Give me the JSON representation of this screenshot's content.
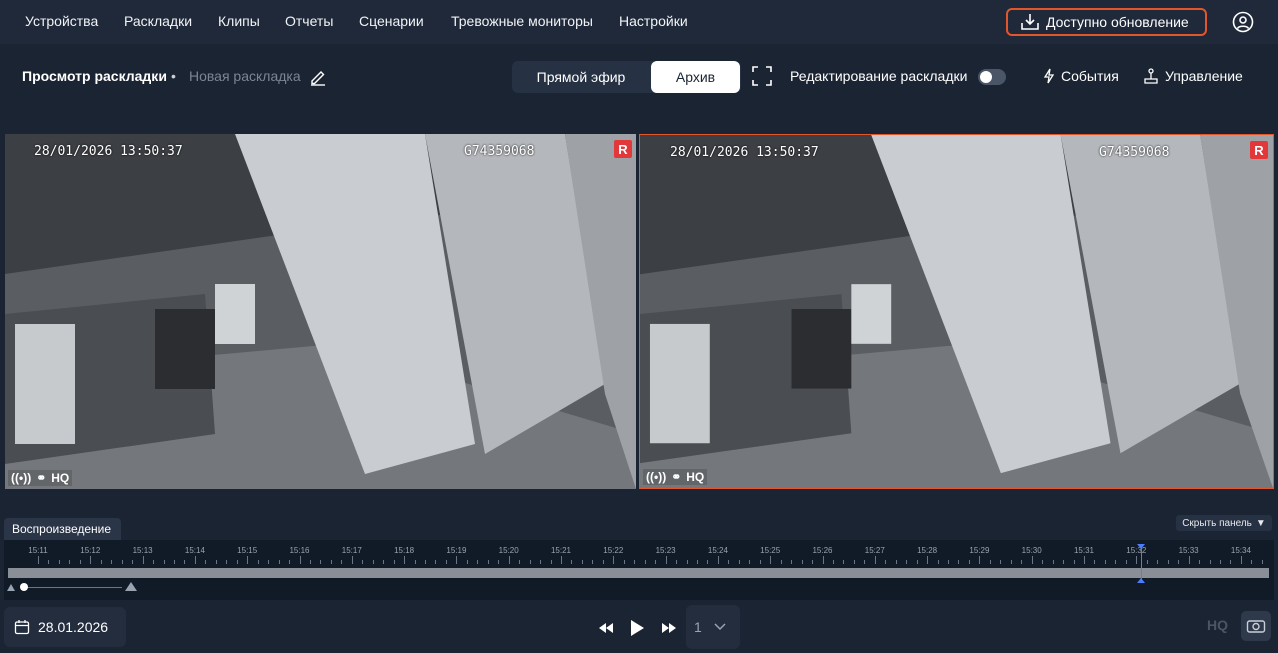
{
  "nav": {
    "items": [
      "Устройства",
      "Раскладки",
      "Клипы",
      "Отчеты",
      "Сценарии",
      "Тревожные мониторы",
      "Настройки"
    ],
    "update_label": "Доступно обновление",
    "update_icon": "download-icon",
    "user_icon": "user-circle-icon"
  },
  "toolbar": {
    "title": "Просмотр раскладки",
    "separator": "•",
    "layout_name": "Новая раскладка",
    "mode_live": "Прямой эфир",
    "mode_archive": "Архив",
    "active_mode": "Архив",
    "edit_layout_label": "Редактирование раскладки",
    "edit_layout_enabled": false,
    "events_label": "События",
    "control_label": "Управление"
  },
  "tiles": [
    {
      "timestamp": "28/01/2026 13:50:37",
      "camera_id": "G74359068",
      "rec_badge": "R",
      "quality": "HQ",
      "selected": false
    },
    {
      "timestamp": "28/01/2026 13:50:37",
      "camera_id": "G74359068",
      "rec_badge": "R",
      "quality": "HQ",
      "selected": true
    }
  ],
  "timeline": {
    "tab_label": "Воспроизведение",
    "hide_panel_label": "Скрыть панель",
    "ticks": [
      "15:11",
      "15:12",
      "15:13",
      "15:14",
      "15:15",
      "15:16",
      "15:17",
      "15:18",
      "15:19",
      "15:20",
      "15:21",
      "15:22",
      "15:23",
      "15:24",
      "15:25",
      "15:26",
      "15:27",
      "15:28",
      "15:29",
      "15:30",
      "15:31",
      "15:32",
      "15:33",
      "15:34"
    ],
    "cursor_time": "15:32"
  },
  "controls": {
    "date": "28.01.2026",
    "speed": "1",
    "hq_label": "HQ"
  },
  "colors": {
    "accent": "#e2562b",
    "background": "#1b2432",
    "cursor": "#4d7cff",
    "rec": "#e2383a"
  }
}
